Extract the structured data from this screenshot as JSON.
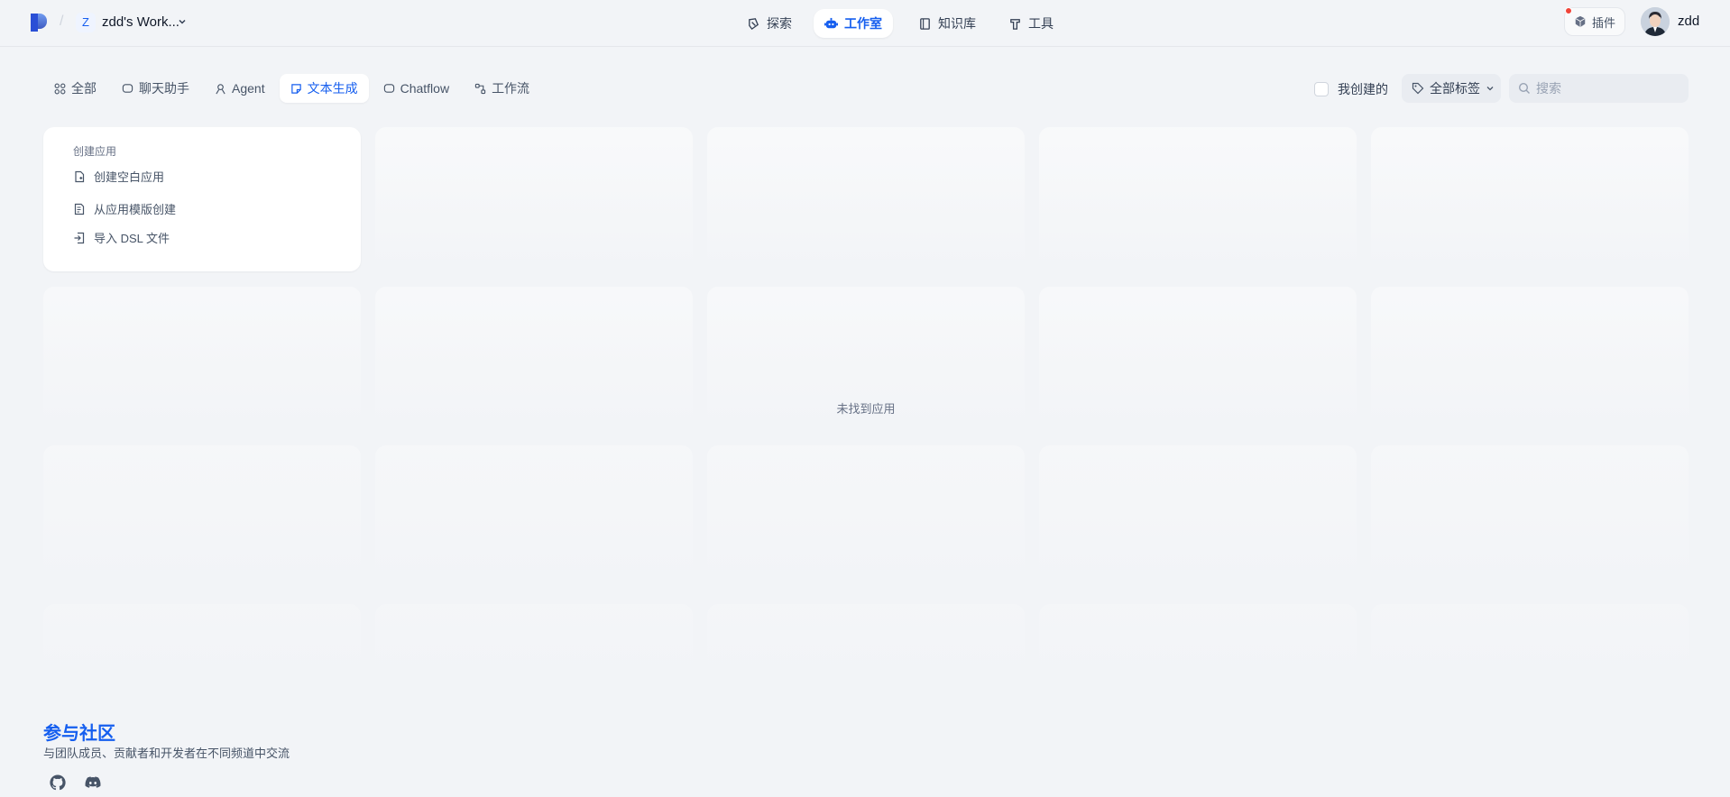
{
  "header": {
    "workspace_initial": "Z",
    "workspace_name": "zdd's Work...",
    "nav": [
      {
        "label": "探索",
        "icon": "compass-icon"
      },
      {
        "label": "工作室",
        "icon": "robot-icon"
      },
      {
        "label": "知识库",
        "icon": "book-icon"
      },
      {
        "label": "工具",
        "icon": "hammer-icon"
      }
    ],
    "plugin_label": "插件",
    "user_name": "zdd"
  },
  "filters": {
    "tabs": [
      {
        "label": "全部"
      },
      {
        "label": "聊天助手"
      },
      {
        "label": "Agent"
      },
      {
        "label": "文本生成"
      },
      {
        "label": "Chatflow"
      },
      {
        "label": "工作流"
      }
    ],
    "active_tab": "文本生成",
    "mine_label": "我创建的",
    "tag_label": "全部标签",
    "search_placeholder": "搜索"
  },
  "create_card": {
    "title": "创建应用",
    "items": [
      {
        "label": "创建空白应用"
      },
      {
        "label": "从应用模版创建"
      },
      {
        "label": "导入 DSL 文件"
      }
    ]
  },
  "empty_message": "未找到应用",
  "community": {
    "title": "参与社区",
    "description": "与团队成员、贡献者和开发者在不同频道中交流"
  },
  "colors": {
    "accent": "#155eef",
    "background": "#f2f4f7"
  }
}
